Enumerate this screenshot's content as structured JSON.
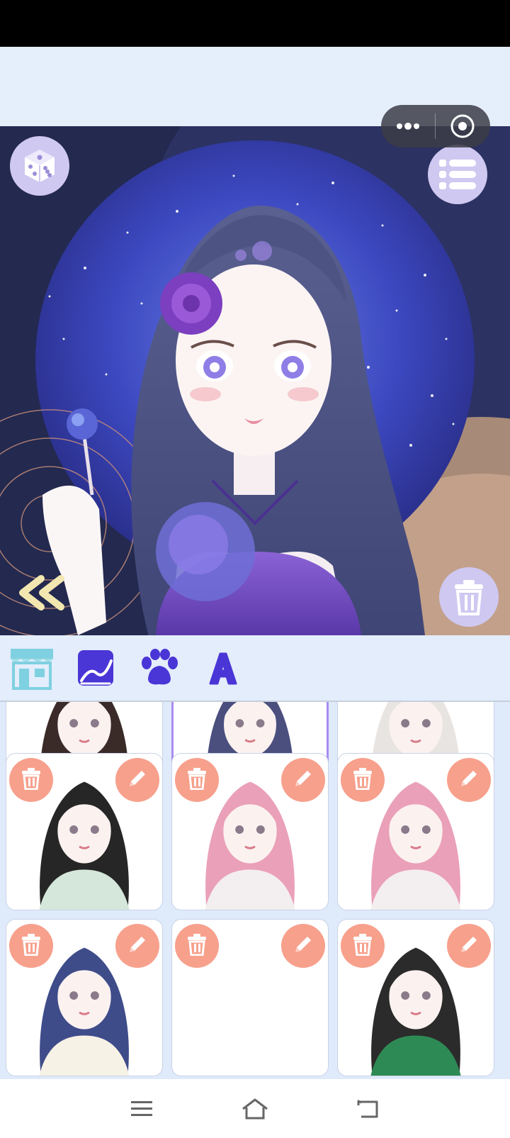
{
  "status_bar": {},
  "mini_program_capsule": {
    "more_icon": "more-dots-icon",
    "close_icon": "target-close-icon"
  },
  "stage": {
    "dice_icon": "dice-icon",
    "menu_icon": "list-menu-icon",
    "collapse_icon": "double-chevron-left-icon",
    "trash_icon": "trash-icon"
  },
  "toolbar": {
    "items": [
      {
        "icon": "shop-icon"
      },
      {
        "icon": "background-image-icon"
      },
      {
        "icon": "paw-icon"
      },
      {
        "icon": "letter-a-icon"
      }
    ]
  },
  "saved_grid": {
    "cards": [
      {
        "state": "partial",
        "selected": false,
        "hair": "#3b2b28",
        "outfit": "#3b2b28"
      },
      {
        "state": "partial",
        "selected": true,
        "hair": "#4a4f7e",
        "outfit": "#6f4fc0"
      },
      {
        "state": "partial",
        "selected": false,
        "hair": "#e8e4e2",
        "outfit": "#eeeeee"
      },
      {
        "state": "full",
        "hair": "#262626",
        "outfit": "#d4e7da"
      },
      {
        "state": "full",
        "hair": "#eaa0b8",
        "outfit": "#f3eef0"
      },
      {
        "state": "full",
        "hair": "#eaa0b8",
        "outfit": "#f3eef0"
      },
      {
        "state": "full",
        "hair": "#3f4c8a",
        "outfit": "#f7f2e6"
      },
      {
        "state": "empty"
      },
      {
        "state": "full",
        "hair": "#2b2b2b",
        "outfit": "#2e8a55"
      }
    ]
  },
  "nav": {
    "menu_icon": "hamburger-icon",
    "home_icon": "home-icon",
    "back_icon": "back-icon"
  },
  "colors": {
    "accent": "#a88cf0",
    "card_button": "#f7a08c",
    "toolbar_icon": "#4a35d6"
  }
}
